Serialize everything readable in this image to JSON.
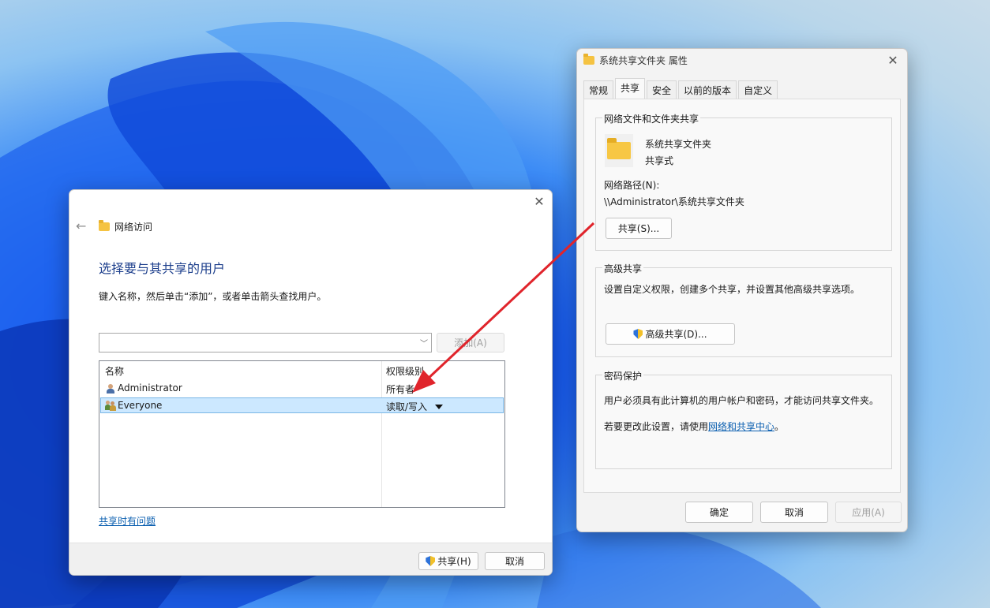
{
  "properties_dialog": {
    "title": "系统共享文件夹 属性",
    "tabs": [
      "常规",
      "共享",
      "安全",
      "以前的版本",
      "自定义"
    ],
    "network_sharing": {
      "group_title": "网络文件和文件夹共享",
      "folder_name": "系统共享文件夹",
      "share_status": "共享式",
      "network_path_label": "网络路径(N):",
      "network_path": "\\\\Administrator\\系统共享文件夹",
      "share_button": "共享(S)..."
    },
    "advanced_sharing": {
      "group_title": "高级共享",
      "description": "设置自定义权限，创建多个共享，并设置其他高级共享选项。",
      "button": "高级共享(D)..."
    },
    "password_protection": {
      "group_title": "密码保护",
      "description": "用户必须具有此计算机的用户帐户和密码，才能访问共享文件夹。",
      "change_prefix": "若要更改此设置，请使用",
      "change_link": "网络和共享中心",
      "change_suffix": "。"
    },
    "footer": {
      "ok": "确定",
      "cancel": "取消",
      "apply": "应用(A)"
    }
  },
  "network_access_dialog": {
    "title": "网络访问",
    "heading": "选择要与其共享的用户",
    "instruction": "键入名称，然后单击“添加”，或者单击箭头查找用户。",
    "add_button": "添加(A)",
    "columns": {
      "name": "名称",
      "permission": "权限级别"
    },
    "users": [
      {
        "name": "Administrator",
        "permission": "所有者"
      },
      {
        "name": "Everyone",
        "permission": "读取/写入"
      }
    ],
    "help_link": "共享时有问题",
    "footer": {
      "share": "共享(H)",
      "cancel": "取消"
    }
  },
  "colors": {
    "accent": "#0b5fb0",
    "heading": "#1d3f8c",
    "arrow": "#e0242b",
    "selection": "#cce8ff"
  }
}
